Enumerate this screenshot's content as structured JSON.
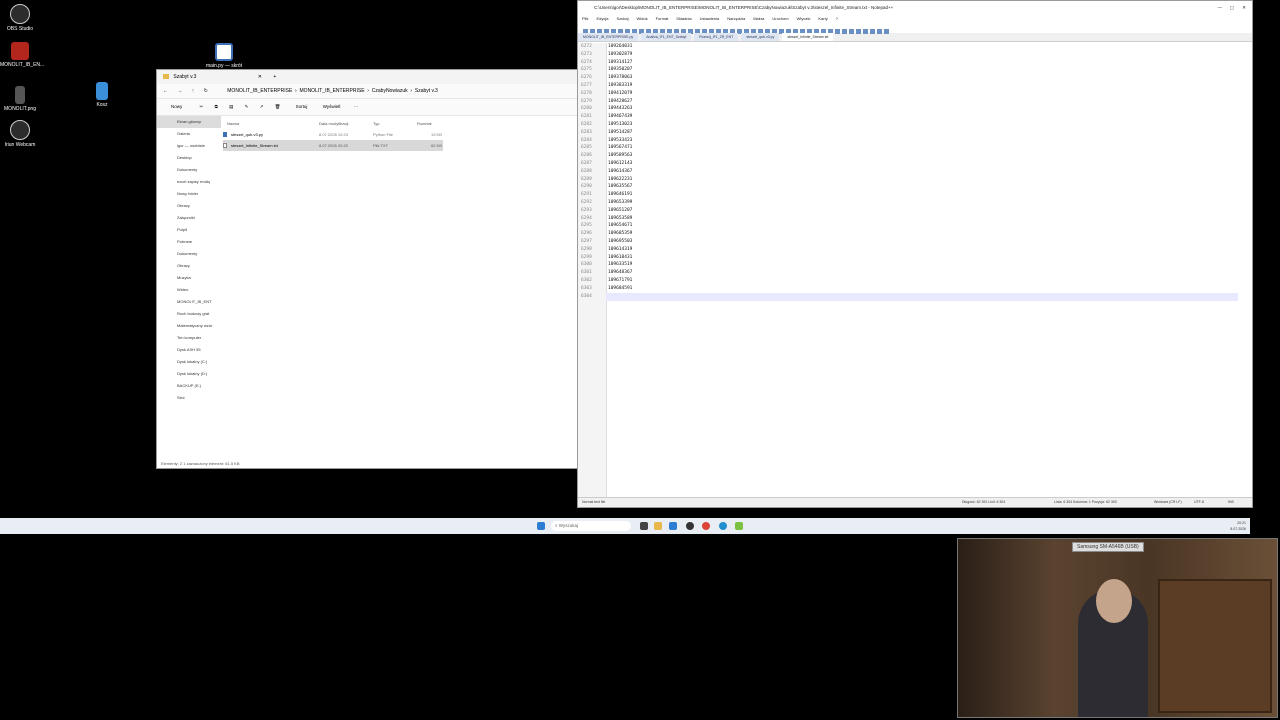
{
  "desktop_icons": [
    {
      "label": "OBS Studio",
      "icon": "obs-icon",
      "color": "#2c2c2c"
    },
    {
      "label": "MONOLIT_IB_EN...",
      "icon": "archive-icon",
      "color": "#b3261e"
    },
    {
      "label": "main.py — skrót",
      "icon": "python-file-icon",
      "color": "#3d6fb6"
    },
    {
      "label": "MONOLIT.png",
      "icon": "image-file-icon",
      "color": "#555555"
    },
    {
      "label": "Kosz",
      "icon": "recycle-bin-icon",
      "color": "#3a8fd8"
    },
    {
      "label": "Iriun Webcam",
      "icon": "webcam-icon",
      "color": "#2c2c2c"
    }
  ],
  "explorer": {
    "tab_title": "Szabyt v.3",
    "path": [
      "MONOLIT_IB_ENTERPRISE",
      "MONOLIT_IB_ENTERPRISE",
      "CzabyNowiazuk",
      "Szabyt v.3"
    ],
    "commands": {
      "new": "Nowy",
      "sort": "Sortuj",
      "view": "Wyświetl"
    },
    "columns": {
      "name": "Nazwa",
      "date": "Data modyfikacji",
      "type": "Typ",
      "size": "Rozmiar"
    },
    "files": [
      {
        "name": "steszel_qub.v3.py",
        "date": "8.07.2026 10:23",
        "type": "Python File",
        "size": "13 KB"
      },
      {
        "name": "steszel_Infinite_Stream.txt",
        "date": "8.07.2026 20:20",
        "type": "Plik TXT",
        "size": "62 KB"
      }
    ],
    "nav_items": [
      "Ekran główny",
      "Galeria",
      "igor — osobiste",
      "Desktop",
      "Dokumenty",
      "excel zapisy rmdiq",
      "Nowy folder",
      "Obrazy",
      "Załączniki",
      "Pulpit",
      "Pobrane",
      "Dokumenty",
      "Obrazy",
      "Muzyka",
      "Wideo",
      "MONOLIT_IB_ENT",
      "Ruch budowy grat",
      "Matematyczny wzór",
      "Ten komputer",
      "Dysk ASH 55",
      "Dysk lokalny (C:)",
      "Dysk lokalny (D:)",
      "BACKUP (E:)",
      "Sieć"
    ],
    "status": "Elementy: 2    1 zaznaczony element: 61,5 KB"
  },
  "notepad": {
    "title": "C:\\Users\\igor\\Desktop\\MONOLIT_IB_ENTERPRISE\\MONOLIT_IB_ENTERPRISE\\CzabyNowiazuk\\Szabyt v.3\\steszel_Infinite_Stream.txt - Notepad++",
    "menu": [
      "Plik",
      "Edycja",
      "Szukaj",
      "Widok",
      "Format",
      "Składnia",
      "Ustawienia",
      "Narzędzia",
      "Makra",
      "Uruchom",
      "Wtyczki",
      "Karty",
      "?"
    ],
    "tabs": [
      "MONOLIT_IB_ENTERPRISE.py",
      "Analiza_IF1_ENT_Szabyt",
      "Rozwój_IF1_ZR_ENT",
      "steszel_qub.v3.py",
      "steszel_Infinite_Stream.txt"
    ],
    "line_numbers": [
      "6272",
      "6273",
      "6274",
      "6275",
      "6276",
      "6277",
      "6278",
      "6279",
      "6280",
      "6281",
      "6282",
      "6283",
      "6284",
      "6285",
      "6286",
      "6287",
      "6288",
      "6289",
      "6290",
      "6291",
      "6292",
      "6293",
      "6294",
      "6295",
      "6296",
      "6297",
      "6298",
      "6299",
      "6300",
      "6301",
      "6302",
      "6303",
      "6304"
    ],
    "lines": [
      "109264031",
      "109302879",
      "109314127",
      "109350207",
      "109378063",
      "109383319",
      "109412079",
      "109428627",
      "109443263",
      "109467439",
      "109513023",
      "109514287",
      "109533423",
      "109567471",
      "109589563",
      "109612143",
      "109614367",
      "109622231",
      "109635567",
      "109646191",
      "109653399",
      "109651207",
      "109653589",
      "109654671",
      "109685359",
      "109695503",
      "109614319",
      "109618431",
      "109633519",
      "109648367",
      "109671791",
      "109684591",
      ""
    ],
    "status_left": "Normal text file",
    "status_length": "Długość: 62 392   Linii: 6 304",
    "status_pos": "Linia: 6 304   Kolumna: 1   Pozycja: 62 393",
    "status_eol": "Windows (CR LF)",
    "status_enc": "UTF-8",
    "status_ins": "INS"
  },
  "taskbar": {
    "search_placeholder": "Wyszukaj",
    "time": "20:21",
    "date": "8.07.2026"
  },
  "webcam": {
    "label": "Samsung SM-A546B (USB)"
  }
}
